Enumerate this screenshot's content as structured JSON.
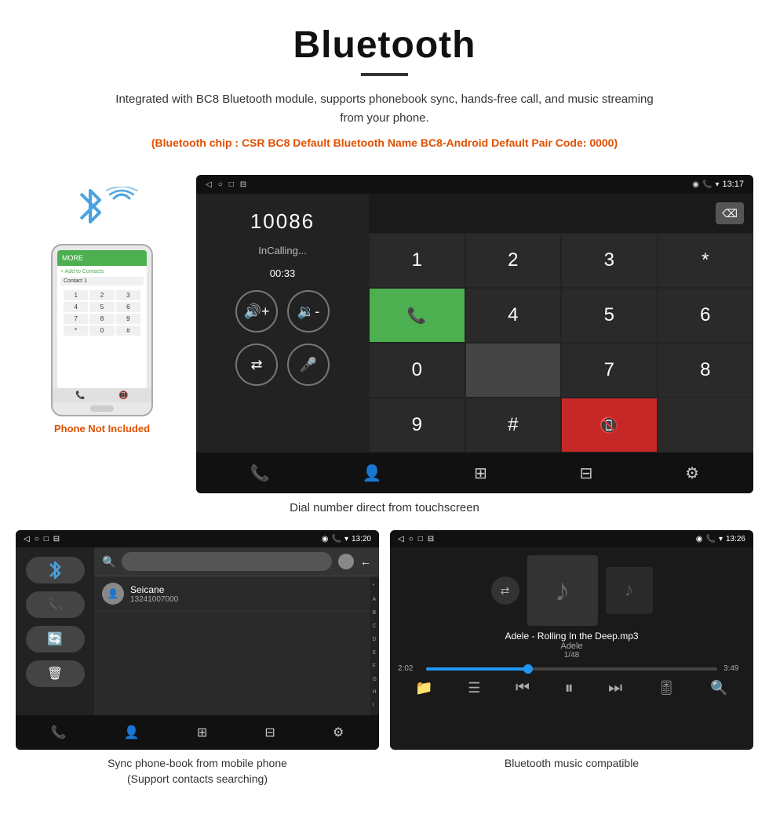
{
  "header": {
    "title": "Bluetooth",
    "description": "Integrated with BC8 Bluetooth module, supports phonebook sync, hands-free call, and music streaming from your phone.",
    "specs": "(Bluetooth chip : CSR BC8    Default Bluetooth Name BC8-Android    Default Pair Code: 0000)"
  },
  "dial_screen": {
    "status_time": "13:17",
    "number": "10086",
    "call_status": "InCalling...",
    "call_timer": "00:33",
    "numpad": [
      "1",
      "2",
      "3",
      "*",
      "",
      "4",
      "5",
      "6",
      "0",
      "",
      "7",
      "8",
      "9",
      "#",
      ""
    ],
    "caption": "Dial number direct from touchscreen"
  },
  "phonebook_screen": {
    "status_time": "13:20",
    "contact_name": "Seicane",
    "contact_number": "13241007000",
    "alphabet": [
      "*",
      "A",
      "B",
      "C",
      "D",
      "E",
      "F",
      "G",
      "H",
      "I"
    ],
    "caption_line1": "Sync phone-book from mobile phone",
    "caption_line2": "(Support contacts searching)"
  },
  "music_screen": {
    "status_time": "13:26",
    "song_name": "Adele - Rolling In the Deep.mp3",
    "artist": "Adele",
    "track_count": "1/48",
    "time_elapsed": "2:02",
    "time_total": "3:49",
    "caption": "Bluetooth music compatible"
  },
  "phone_not_included": "Phone Not Included"
}
